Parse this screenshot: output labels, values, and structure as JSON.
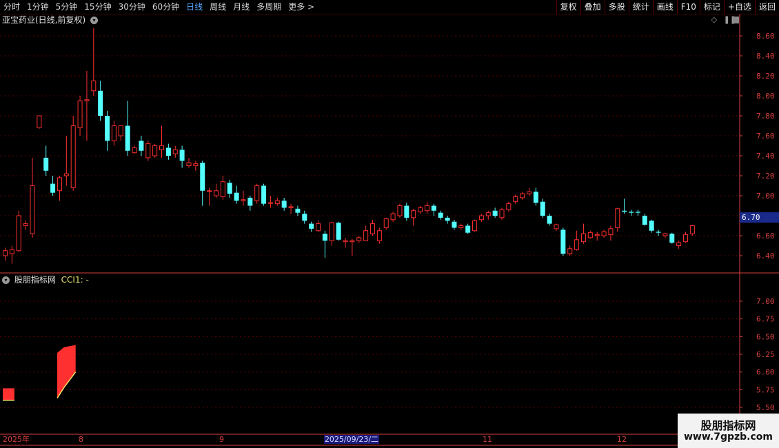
{
  "toolbar": {
    "periods": [
      {
        "label": "分时",
        "active": false
      },
      {
        "label": "1分钟",
        "active": false
      },
      {
        "label": "5分钟",
        "active": false
      },
      {
        "label": "15分钟",
        "active": false
      },
      {
        "label": "30分钟",
        "active": false
      },
      {
        "label": "60分钟",
        "active": false
      },
      {
        "label": "日线",
        "active": true
      },
      {
        "label": "周线",
        "active": false
      },
      {
        "label": "月线",
        "active": false
      },
      {
        "label": "多周期",
        "active": false
      },
      {
        "label": "更多 >",
        "active": false
      }
    ],
    "buttons": [
      "复权",
      "叠加",
      "多股",
      "统计",
      "画线",
      "F10",
      "标记",
      "+自选",
      "返回"
    ]
  },
  "main_chart": {
    "title": "亚宝药业(日线,前复权)",
    "y_ticks": [
      "8.60",
      "8.40",
      "8.20",
      "8.00",
      "7.80",
      "7.60",
      "7.40",
      "7.20",
      "7.00",
      "6.80",
      "6.60",
      "6.40"
    ],
    "current_price": "6.70"
  },
  "indicator": {
    "title": "股朋指标网",
    "cci_label": "CCI1: -",
    "y_ticks": [
      "7.00",
      "6.75",
      "6.50",
      "6.25",
      "6.00",
      "5.75",
      "5.50"
    ]
  },
  "x_axis": {
    "labels": [
      "2025年",
      "8",
      "9",
      "11",
      "12"
    ],
    "highlight": "2025/09/23/二"
  },
  "watermark": {
    "title": "股朋指标网",
    "url": "www.7gpzb.com"
  },
  "colors": {
    "up": "#ff3030",
    "down": "#54ffff",
    "axis": "#d84040",
    "grid": "#5a0000"
  },
  "chart_data": {
    "type": "candlestick",
    "ylim": [
      6.3,
      8.7
    ],
    "candles": [
      [
        6.4,
        6.45,
        6.35,
        6.48
      ],
      [
        6.42,
        6.46,
        6.32,
        6.5
      ],
      [
        6.45,
        6.8,
        6.44,
        6.85
      ],
      [
        6.7,
        6.72,
        6.66,
        6.75
      ],
      [
        6.62,
        7.1,
        6.58,
        7.38
      ],
      [
        7.68,
        7.8,
        7.67,
        7.8
      ],
      [
        7.38,
        7.25,
        7.2,
        7.5
      ],
      [
        7.12,
        7.03,
        7.0,
        7.2
      ],
      [
        7.05,
        7.18,
        6.95,
        7.2
      ],
      [
        7.2,
        7.22,
        7.1,
        7.6
      ],
      [
        7.08,
        7.7,
        7.05,
        7.8
      ],
      [
        7.68,
        7.95,
        7.6,
        8.0
      ],
      [
        7.95,
        7.96,
        7.55,
        8.25
      ],
      [
        8.05,
        8.15,
        8.0,
        8.68
      ],
      [
        8.05,
        7.8,
        7.75,
        8.15
      ],
      [
        7.8,
        7.55,
        7.45,
        7.85
      ],
      [
        7.55,
        7.7,
        7.5,
        7.75
      ],
      [
        7.6,
        7.7,
        7.55,
        7.7
      ],
      [
        7.7,
        7.45,
        7.4,
        7.95
      ],
      [
        7.43,
        7.48,
        7.42,
        7.5
      ],
      [
        7.55,
        7.45,
        7.4,
        7.6
      ],
      [
        7.38,
        7.52,
        7.35,
        7.55
      ],
      [
        7.4,
        7.5,
        7.38,
        7.52
      ],
      [
        7.46,
        7.5,
        7.38,
        7.7
      ],
      [
        7.48,
        7.4,
        7.36,
        7.52
      ],
      [
        7.42,
        7.46,
        7.38,
        7.5
      ],
      [
        7.46,
        7.35,
        7.28,
        7.5
      ],
      [
        7.3,
        7.33,
        7.28,
        7.38
      ],
      [
        7.3,
        7.32,
        7.25,
        7.35
      ],
      [
        7.33,
        7.05,
        6.9,
        7.35
      ],
      [
        7.05,
        7.05,
        6.9,
        7.08
      ],
      [
        7.0,
        7.05,
        6.98,
        7.12
      ],
      [
        6.99,
        7.14,
        6.96,
        7.2
      ],
      [
        7.13,
        7.02,
        6.98,
        7.16
      ],
      [
        7.03,
        6.95,
        6.92,
        7.1
      ],
      [
        6.95,
        6.96,
        6.9,
        7.05
      ],
      [
        6.98,
        6.9,
        6.85,
        7.0
      ],
      [
        6.95,
        7.1,
        6.92,
        7.12
      ],
      [
        7.1,
        6.92,
        6.9,
        7.12
      ],
      [
        6.93,
        6.93,
        6.88,
        7.0
      ],
      [
        6.92,
        6.95,
        6.9,
        6.98
      ],
      [
        6.95,
        6.88,
        6.85,
        6.98
      ],
      [
        6.88,
        6.89,
        6.82,
        6.92
      ],
      [
        6.87,
        6.83,
        6.8,
        6.9
      ],
      [
        6.82,
        6.75,
        6.72,
        6.85
      ],
      [
        6.72,
        6.67,
        6.64,
        6.74
      ],
      [
        6.65,
        6.72,
        6.64,
        6.75
      ],
      [
        6.62,
        6.55,
        6.38,
        6.65
      ],
      [
        6.55,
        6.73,
        6.5,
        6.74
      ],
      [
        6.73,
        6.56,
        6.55,
        6.74
      ],
      [
        6.54,
        6.55,
        6.48,
        6.58
      ],
      [
        6.54,
        6.55,
        6.4,
        6.57
      ],
      [
        6.55,
        6.58,
        6.53,
        6.6
      ],
      [
        6.55,
        6.65,
        6.55,
        6.7
      ],
      [
        6.62,
        6.72,
        6.6,
        6.76
      ],
      [
        6.55,
        6.65,
        6.52,
        6.68
      ],
      [
        6.68,
        6.77,
        6.66,
        6.78
      ],
      [
        6.76,
        6.82,
        6.74,
        6.84
      ],
      [
        6.8,
        6.9,
        6.78,
        6.92
      ],
      [
        6.9,
        6.78,
        6.75,
        6.93
      ],
      [
        6.78,
        6.85,
        6.7,
        6.87
      ],
      [
        6.84,
        6.88,
        6.82,
        6.9
      ],
      [
        6.85,
        6.9,
        6.82,
        6.94
      ],
      [
        6.9,
        6.85,
        6.8,
        6.92
      ],
      [
        6.83,
        6.78,
        6.76,
        6.85
      ],
      [
        6.78,
        6.75,
        6.72,
        6.8
      ],
      [
        6.74,
        6.68,
        6.66,
        6.76
      ],
      [
        6.68,
        6.7,
        6.66,
        6.72
      ],
      [
        6.7,
        6.63,
        6.62,
        6.72
      ],
      [
        6.65,
        6.75,
        6.64,
        6.76
      ],
      [
        6.76,
        6.8,
        6.74,
        6.82
      ],
      [
        6.8,
        6.83,
        6.76,
        6.85
      ],
      [
        6.85,
        6.8,
        6.78,
        6.88
      ],
      [
        6.78,
        6.86,
        6.76,
        6.88
      ],
      [
        6.86,
        6.92,
        6.84,
        6.94
      ],
      [
        6.94,
        6.99,
        6.92,
        7.01
      ],
      [
        6.98,
        7.02,
        6.96,
        7.04
      ],
      [
        7.02,
        7.04,
        7.0,
        7.08
      ],
      [
        7.04,
        6.93,
        6.9,
        7.08
      ],
      [
        6.94,
        6.8,
        6.78,
        6.97
      ],
      [
        6.8,
        6.72,
        6.7,
        6.82
      ],
      [
        6.67,
        6.71,
        6.65,
        6.72
      ],
      [
        6.66,
        6.42,
        6.4,
        6.68
      ],
      [
        6.42,
        6.47,
        6.4,
        6.5
      ],
      [
        6.46,
        6.56,
        6.45,
        6.65
      ],
      [
        6.54,
        6.62,
        6.52,
        6.72
      ],
      [
        6.58,
        6.63,
        6.57,
        6.65
      ],
      [
        6.6,
        6.61,
        6.55,
        6.64
      ],
      [
        6.6,
        6.64,
        6.58,
        6.66
      ],
      [
        6.61,
        6.67,
        6.55,
        6.7
      ],
      [
        6.68,
        6.87,
        6.64,
        6.88
      ],
      [
        6.85,
        6.84,
        6.82,
        6.97
      ],
      [
        6.84,
        6.83,
        6.8,
        6.86
      ],
      [
        6.84,
        6.83,
        6.8,
        6.86
      ],
      [
        6.8,
        6.71,
        6.7,
        6.82
      ],
      [
        6.75,
        6.65,
        6.63,
        6.76
      ],
      [
        6.64,
        6.63,
        6.6,
        6.66
      ],
      [
        6.6,
        6.62,
        6.58,
        6.63
      ],
      [
        6.62,
        6.53,
        6.52,
        6.63
      ],
      [
        6.5,
        6.53,
        6.47,
        6.55
      ],
      [
        6.54,
        6.61,
        6.53,
        6.64
      ],
      [
        6.62,
        6.7,
        6.6,
        6.71
      ]
    ],
    "indicator_series": [
      {
        "x0": 0,
        "x1": 1,
        "low": [
          5.6,
          5.6
        ],
        "high": [
          5.77,
          5.77
        ]
      },
      {
        "x0": 8,
        "x1": 10,
        "low": [
          5.63,
          5.78,
          6.0
        ],
        "high": [
          6.27,
          6.35,
          6.38
        ]
      }
    ]
  }
}
